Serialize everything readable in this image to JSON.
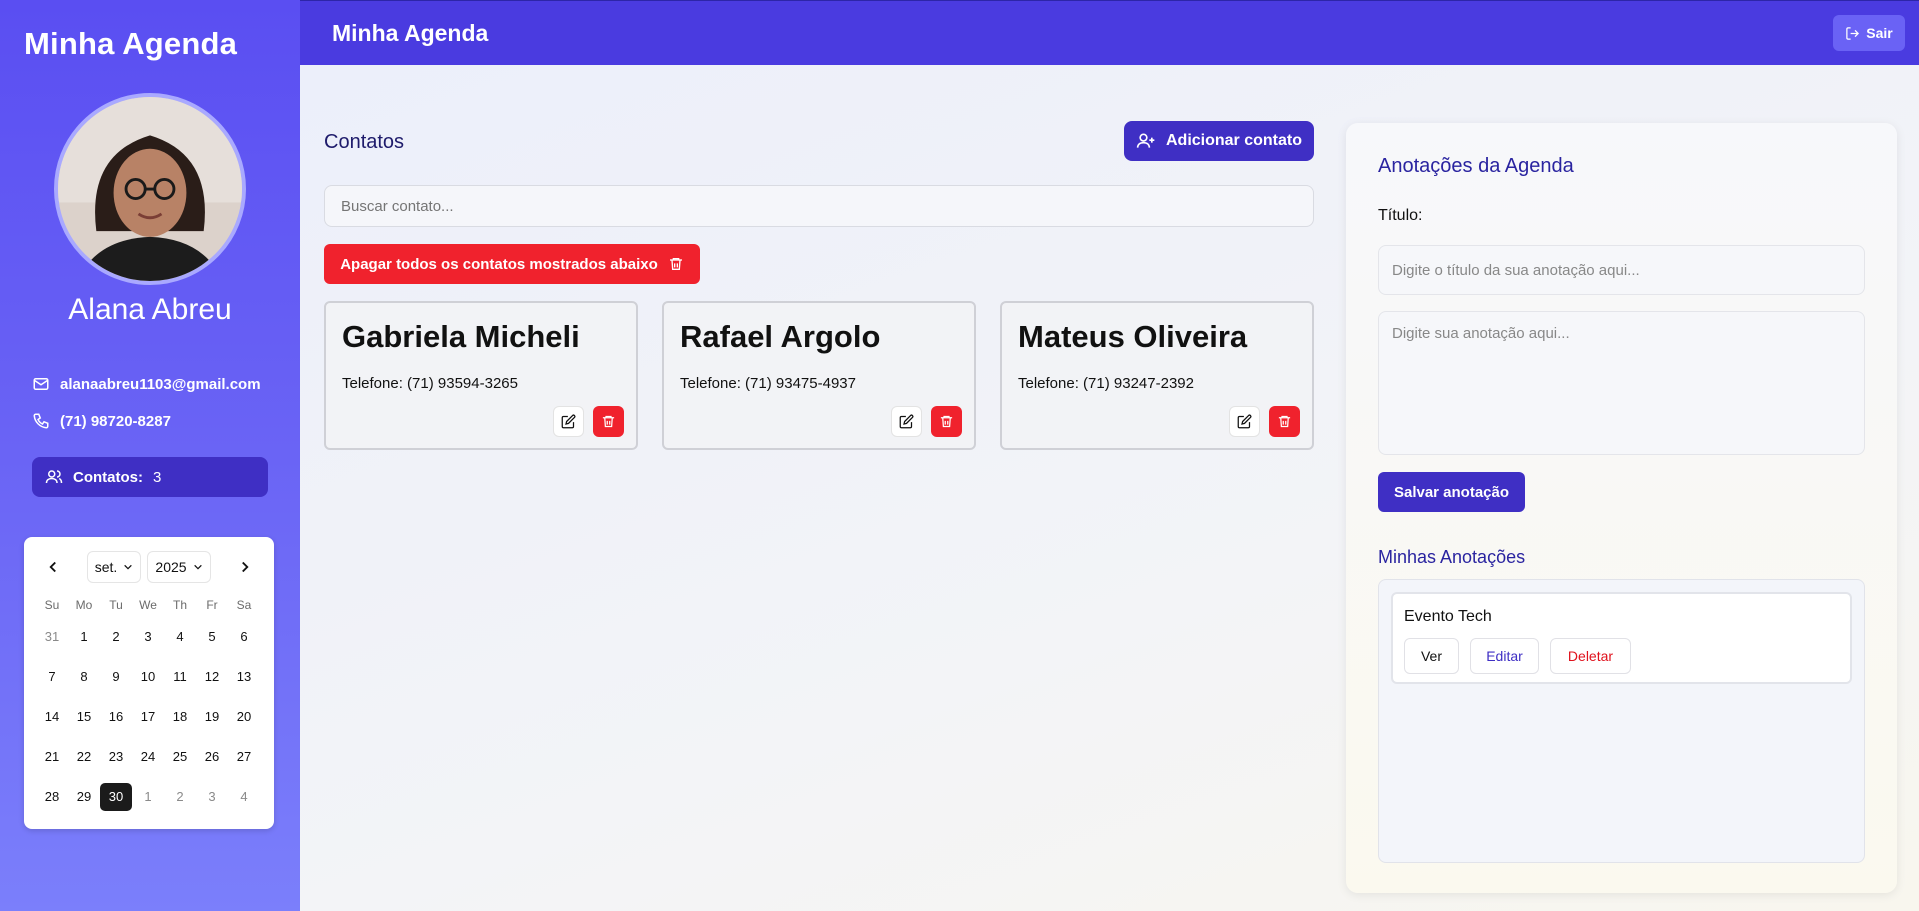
{
  "sidebar": {
    "title": "Minha Agenda",
    "user_name": "Alana Abreu",
    "email": "alanaabreu1103@gmail.com",
    "phone": "(71) 98720-8287",
    "contacts_label": "Contatos:",
    "contacts_count": "3",
    "icons": [
      "mail-icon",
      "phone-icon",
      "users-icon"
    ]
  },
  "calendar": {
    "month": "set.",
    "year": "2025",
    "weekdays": [
      "Su",
      "Mo",
      "Tu",
      "We",
      "Th",
      "Fr",
      "Sa"
    ],
    "weeks": [
      [
        "31",
        "1",
        "2",
        "3",
        "4",
        "5",
        "6"
      ],
      [
        "7",
        "8",
        "9",
        "10",
        "11",
        "12",
        "13"
      ],
      [
        "14",
        "15",
        "16",
        "17",
        "18",
        "19",
        "20"
      ],
      [
        "21",
        "22",
        "23",
        "24",
        "25",
        "26",
        "27"
      ],
      [
        "28",
        "29",
        "30",
        "1",
        "2",
        "3",
        "4"
      ]
    ],
    "selected": "30"
  },
  "header": {
    "title": "Minha Agenda",
    "logout_label": "Sair"
  },
  "contacts": {
    "title": "Contatos",
    "add_label": "Adicionar contato",
    "search_placeholder": "Buscar contato...",
    "delete_all_label": "Apagar todos os contatos mostrados abaixo",
    "cards": [
      {
        "name": "Gabriela Micheli",
        "phone": "Telefone: (71) 93594-3265"
      },
      {
        "name": "Rafael Argolo",
        "phone": "Telefone: (71) 93475-4937"
      },
      {
        "name": "Mateus Oliveira",
        "phone": "Telefone: (71) 93247-2392"
      }
    ]
  },
  "notes": {
    "title": "Anotações da Agenda",
    "title_label": "Título:",
    "title_placeholder": "Digite o título da sua anotação aqui...",
    "body_placeholder": "Digite sua anotação aqui...",
    "save_label": "Salvar anotação",
    "mine_title": "Minhas Anotações",
    "items": [
      {
        "name": "Evento Tech",
        "view_label": "Ver",
        "edit_label": "Editar",
        "delete_label": "Deletar"
      }
    ]
  },
  "colors": {
    "primary": "#3f2fc4",
    "header": "#4a3be0",
    "danger": "#f0222d"
  }
}
